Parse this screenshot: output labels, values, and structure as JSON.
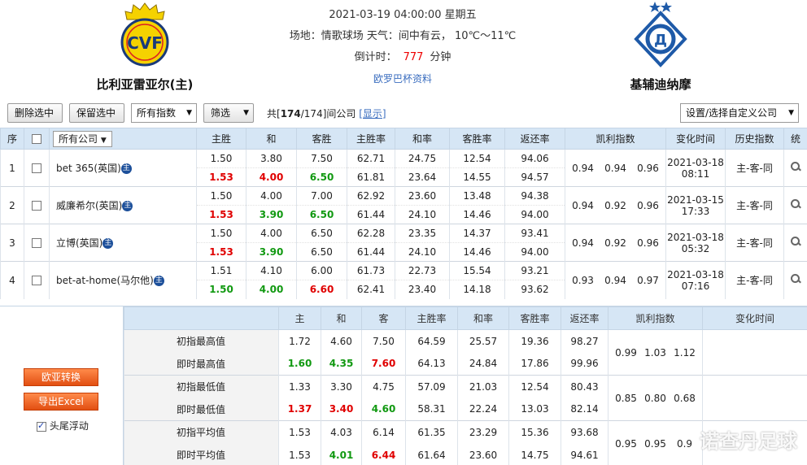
{
  "header": {
    "datetime": "2021-03-19 04:00:00 星期五",
    "venue_weather": "场地：情歌球场 天气：间中有云， 10℃～11℃",
    "countdown_label": "倒计时：",
    "countdown_value": "777",
    "countdown_unit": "分钟",
    "competition_link": "欧罗巴杯资料",
    "home_team": "比利亚雷亚尔(主)",
    "away_team": "基辅迪纳摩",
    "home_logo_color": "#f5d200",
    "away_logo_color": "#1e5aa8"
  },
  "toolbar": {
    "delete_selected": "删除选中",
    "keep_selected": "保留选中",
    "index_select": "所有指数",
    "filter_select": "筛选",
    "count_prefix": "共[",
    "count_value": "174",
    "count_total": "/174]间公司",
    "show_link": "[显示]",
    "custom_company": "设置/选择自定义公司"
  },
  "columns": {
    "seq": "序",
    "company": "所有公司",
    "home": "主胜",
    "draw": "和",
    "away": "客胜",
    "home_rate": "主胜率",
    "draw_rate": "和率",
    "away_rate": "客胜率",
    "return_rate": "返还率",
    "kelly": "凯利指数",
    "change_time": "变化时间",
    "history": "历史指数",
    "stat": "统"
  },
  "rows": [
    {
      "seq": "1",
      "company": "bet 365(英国)",
      "tag": "主",
      "init": [
        "1.50",
        "3.80",
        "7.50",
        "62.71",
        "24.75",
        "12.54",
        "94.06"
      ],
      "live": [
        "1.53",
        "4.00",
        "6.50",
        "61.81",
        "23.64",
        "14.55",
        "94.57"
      ],
      "kelly": [
        "0.94",
        "0.94",
        "0.96"
      ],
      "date": "2021-03-18",
      "time": "08:11",
      "history": "主-客-同"
    },
    {
      "seq": "2",
      "company": "威廉希尔(英国)",
      "tag": "主",
      "init": [
        "1.50",
        "4.00",
        "7.00",
        "62.92",
        "23.60",
        "13.48",
        "94.38"
      ],
      "live": [
        "1.53",
        "3.90",
        "6.50",
        "61.44",
        "24.10",
        "14.46",
        "94.00"
      ],
      "kelly": [
        "0.94",
        "0.92",
        "0.96"
      ],
      "date": "2021-03-15",
      "time": "17:33",
      "history": "主-客-同"
    },
    {
      "seq": "3",
      "company": "立博(英国)",
      "tag": "主",
      "init": [
        "1.50",
        "4.00",
        "6.50",
        "62.28",
        "23.35",
        "14.37",
        "93.41"
      ],
      "live": [
        "1.53",
        "3.90",
        "6.50",
        "61.44",
        "24.10",
        "14.46",
        "94.00"
      ],
      "kelly": [
        "0.94",
        "0.92",
        "0.96"
      ],
      "date": "2021-03-18",
      "time": "05:32",
      "history": "主-客-同"
    },
    {
      "seq": "4",
      "company": "bet-at-home(马尔他)",
      "tag": "主",
      "init": [
        "1.51",
        "4.10",
        "6.00",
        "61.73",
        "22.73",
        "15.54",
        "93.21"
      ],
      "live": [
        "1.50",
        "4.00",
        "6.60",
        "62.41",
        "23.40",
        "14.18",
        "93.62"
      ],
      "kelly": [
        "0.93",
        "0.94",
        "0.97"
      ],
      "date": "2021-03-18",
      "time": "07:16",
      "history": "主-客-同"
    }
  ],
  "summary": {
    "headers": {
      "home": "主",
      "draw": "和",
      "away": "客",
      "home_rate": "主胜率",
      "draw_rate": "和率",
      "away_rate": "客胜率",
      "return_rate": "返还率",
      "kelly": "凯利指数",
      "change_time": "变化时间"
    },
    "convert_button": "欧亚转换",
    "export_button": "导出Excel",
    "float_label": "头尾浮动",
    "groups": [
      {
        "rows": [
          {
            "label": "初指最高值",
            "vals": [
              "1.72",
              "4.60",
              "7.50",
              "64.59",
              "25.57",
              "19.36",
              "98.27"
            ]
          },
          {
            "label": "即时最高值",
            "vals": [
              "1.60",
              "4.35",
              "7.60",
              "64.13",
              "24.84",
              "17.86",
              "99.96"
            ]
          }
        ],
        "kelly": [
          "0.99",
          "1.03",
          "1.12"
        ]
      },
      {
        "rows": [
          {
            "label": "初指最低值",
            "vals": [
              "1.33",
              "3.30",
              "4.75",
              "57.09",
              "21.03",
              "12.54",
              "80.43"
            ]
          },
          {
            "label": "即时最低值",
            "vals": [
              "1.37",
              "3.40",
              "4.60",
              "58.31",
              "22.24",
              "13.03",
              "82.14"
            ]
          }
        ],
        "kelly": [
          "0.85",
          "0.80",
          "0.68"
        ]
      },
      {
        "rows": [
          {
            "label": "初指平均值",
            "vals": [
              "1.53",
              "4.03",
              "6.14",
              "61.35",
              "23.29",
              "15.36",
              "93.68"
            ]
          },
          {
            "label": "即时平均值",
            "vals": [
              "1.53",
              "4.01",
              "6.44",
              "61.64",
              "23.60",
              "14.75",
              "94.61"
            ]
          }
        ],
        "kelly": [
          "0.95",
          "0.95",
          "0.9"
        ]
      }
    ]
  },
  "watermark": "诺查丹足球"
}
